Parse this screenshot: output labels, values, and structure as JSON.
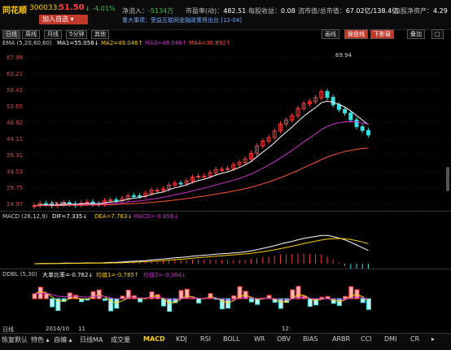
{
  "stock": {
    "name": "同花顺",
    "code": "300033:",
    "price": "51.50",
    "change": "↓ -4.01%",
    "add_button": "加入自选 ▾"
  },
  "stats": {
    "net_inflow_label": "净流入：",
    "net_inflow_value": "-5134万",
    "pe_label": "市盈率(动)：",
    "pe_value": "482.51",
    "eps_label": "每股收益：",
    "eps_value": "0.08",
    "mcap_label": "流市值/总市值：",
    "mcap_value": "67.02亿/138.4亿",
    "nav_label": "每股净资产：",
    "nav_value": "4.29"
  },
  "news": "重大事项：受益互联网金融政策将出台   [12-04]",
  "tabs": [
    "日线",
    "周线",
    "月线",
    "5分钟",
    "其他"
  ],
  "right_buttons": [
    "画线",
    "操盘线",
    "下影窗",
    "叠加",
    "□"
  ],
  "main_indicator": {
    "label": "EMA (5,20,60,60)",
    "ma1": "MA1=55.058↓",
    "ma2": "MA2=49.046↑",
    "ma3": "MA3=49.046↑",
    "ma4": "MA4=36.892↑",
    "y_ticks": [
      "67.99",
      "63.21",
      "58.43",
      "53.65",
      "48.92",
      "44.11",
      "39.31",
      "34.53",
      "29.75",
      "24.97"
    ],
    "high_marker": "69.94",
    "low_marker": "23.35"
  },
  "macd": {
    "label": "MACD (26,12,9)",
    "dif": "DIF=7.335↓",
    "dea": "DEA=7.763↓",
    "macd": "MACD=-0.856↓"
  },
  "dbdl": {
    "label": "DDBL (5,30)",
    "big": "大单比率=-0.762↓",
    "avg1": "均值1=-0.785↑",
    "avg2": "均值2=-0.364↓"
  },
  "date_axis": {
    "label": "日线",
    "d1": "2014/10",
    "d2": "11",
    "d3": "12"
  },
  "bottom_tabs": [
    "恢复默认",
    "特色 ▴",
    "自编 ▴",
    "日线MA",
    "成交量",
    "MACD",
    "KDJ",
    "RSI",
    "BOLL",
    "WR",
    "OBV",
    "BIAS",
    "ARBR",
    "CCI",
    "DMI",
    "CR",
    "▸"
  ],
  "active_bottom_tab": "MACD",
  "colors": {
    "up": "#ff3b3b",
    "down": "#36e0e0",
    "ma1": "#ffffff",
    "ma2": "#cc33cc",
    "ma3": "#ff5533",
    "accent": "#ffcc00"
  }
}
